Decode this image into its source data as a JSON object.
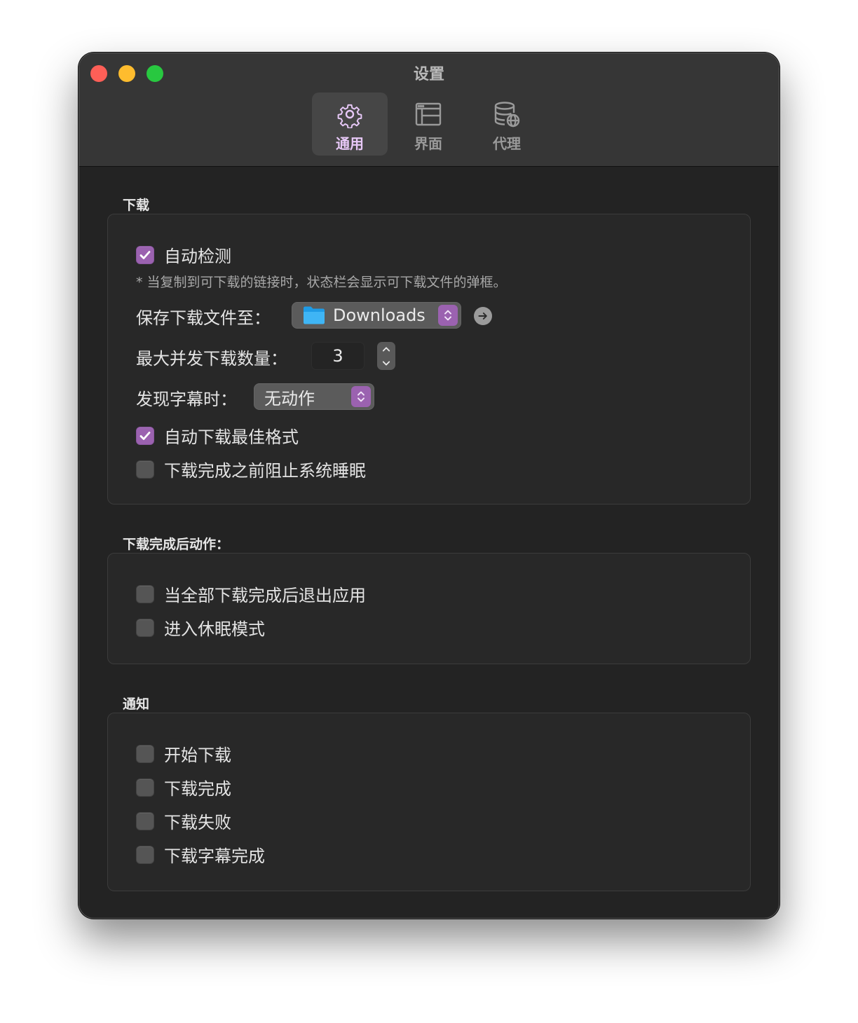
{
  "window": {
    "title": "设置"
  },
  "tabs": [
    {
      "label": "通用",
      "icon": "gear-icon",
      "active": true
    },
    {
      "label": "界面",
      "icon": "layout-icon",
      "active": false
    },
    {
      "label": "代理",
      "icon": "database-globe-icon",
      "active": false
    }
  ],
  "download": {
    "section_label": "下载",
    "auto_detect": {
      "label": "自动检测",
      "checked": true
    },
    "auto_detect_note": "* 当复制到可下载的链接时，状态栏会显示可下载文件的弹框。",
    "save_to": {
      "label": "保存下载文件至：",
      "value": "Downloads",
      "icon": "folder-icon"
    },
    "max_concurrent": {
      "label": "最大并发下载数量：",
      "value": "3"
    },
    "subtitle_found": {
      "label": "发现字幕时：",
      "value": "无动作"
    },
    "auto_best_format": {
      "label": "自动下载最佳格式",
      "checked": true
    },
    "prevent_sleep": {
      "label": "下载完成之前阻止系统睡眠",
      "checked": false
    }
  },
  "after_download": {
    "section_label": "下载完成后动作：",
    "items": [
      {
        "label": "当全部下载完成后退出应用",
        "checked": false
      },
      {
        "label": "进入休眠模式",
        "checked": false
      }
    ]
  },
  "notifications": {
    "section_label": "通知",
    "items": [
      {
        "label": "开始下载",
        "checked": false
      },
      {
        "label": "下载完成",
        "checked": false
      },
      {
        "label": "下载失败",
        "checked": false
      },
      {
        "label": "下载字幕完成",
        "checked": false
      }
    ]
  },
  "colors": {
    "accent": "#9b62b0",
    "accent_text": "#e7c8f7",
    "window_bg": "#232323",
    "titlebar_bg": "#363636"
  }
}
